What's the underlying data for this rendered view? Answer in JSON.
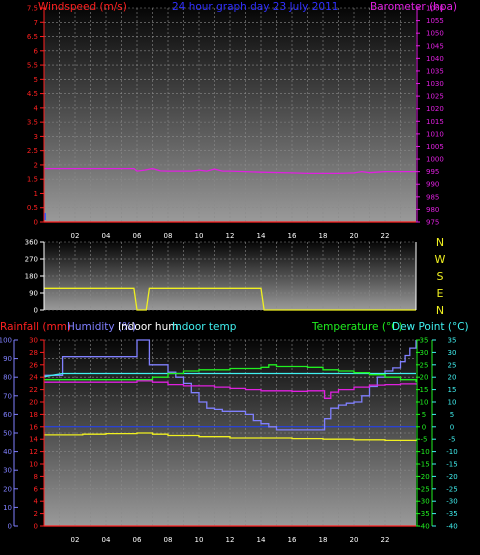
{
  "chart_data": [
    {
      "type": "line",
      "title": "24 hour graph day   23 July 2011",
      "left_axis_label": "Windspeed (m/s)",
      "right_axis_label": "Barometer (hpa)",
      "x_ticks": [
        "02",
        "04",
        "06",
        "08",
        "10",
        "12",
        "14",
        "16",
        "18",
        "20",
        "22"
      ],
      "xlim": [
        0,
        24
      ],
      "left_ylim": [
        0,
        7.5
      ],
      "left_ticks": [
        "0",
        "0.5",
        "1",
        "1.5",
        "2",
        "2.5",
        "3",
        "3.5",
        "4",
        "4.5",
        "5",
        "5.5",
        "6",
        "6.5",
        "7",
        "7.5"
      ],
      "right_ylim": [
        975,
        1060
      ],
      "right_ticks": [
        "975",
        "980",
        "985",
        "990",
        "995",
        "1000",
        "1005",
        "1010",
        "1015",
        "1020",
        "1025",
        "1030",
        "1035",
        "1040",
        "1045",
        "1050",
        "1055",
        "1060"
      ],
      "grid": true,
      "series": [
        {
          "name": "Windspeed (m/s)",
          "axis": "left",
          "color": "#ff2020",
          "x": [
            0,
            24
          ],
          "y": [
            0,
            0
          ]
        },
        {
          "name": "Barometer (hpa)",
          "axis": "right",
          "color": "#e020e0",
          "x": [
            0,
            5.8,
            6.0,
            6.5,
            7.0,
            7.5,
            8.0,
            9.5,
            10.0,
            10.5,
            11.0,
            11.5,
            12.0,
            14.0,
            16.0,
            17.0,
            18.0,
            19.0,
            20.0,
            20.5,
            21.0,
            22.0,
            23.0,
            24.0
          ],
          "y": [
            996.2,
            996.2,
            995.2,
            995.6,
            996.2,
            995.3,
            995.2,
            995.2,
            995.6,
            995.2,
            996.0,
            995.2,
            995.2,
            994.8,
            994.5,
            994.3,
            994.3,
            994.3,
            994.5,
            995.0,
            994.6,
            995.0,
            995.0,
            995.0
          ]
        }
      ]
    },
    {
      "type": "line",
      "title": "",
      "left_ticks": [
        "0",
        "90",
        "180",
        "270",
        "360"
      ],
      "left_ylim": [
        0,
        360
      ],
      "direction_labels": [
        "N",
        "W",
        "S",
        "E",
        "N"
      ],
      "xlim": [
        0,
        24
      ],
      "grid": true,
      "series": [
        {
          "name": "Wind direction",
          "color": "#f0f020",
          "x": [
            0,
            5.8,
            6.0,
            6.6,
            6.8,
            14.0,
            14.2,
            24
          ],
          "y": [
            115,
            115,
            0,
            0,
            115,
            115,
            0,
            0
          ]
        }
      ]
    },
    {
      "type": "line",
      "title": "",
      "labels": {
        "rainfall": "Rainfall (mm)",
        "humidity": "Humidity (%)",
        "indoor_hum": "Indoor hum",
        "indoor_temp": "Indoor temp",
        "temperature": "Temperature (°C)",
        "dew_point": "Dew Point (°C)"
      },
      "x_ticks": [
        "02",
        "04",
        "06",
        "08",
        "10",
        "12",
        "14",
        "16",
        "18",
        "20",
        "22"
      ],
      "xlim": [
        0,
        24
      ],
      "rain_ylim": [
        0,
        100
      ],
      "rain_ticks": [
        "0",
        "10",
        "20",
        "30",
        "40",
        "50",
        "60",
        "70",
        "80",
        "90",
        "100"
      ],
      "hum_ylim": [
        0,
        30
      ],
      "hum_ticks": [
        "0",
        "2",
        "4",
        "6",
        "8",
        "10",
        "12",
        "14",
        "16",
        "18",
        "20",
        "22",
        "24",
        "26",
        "28",
        "30"
      ],
      "temp_ylim": [
        -40,
        35
      ],
      "temp_ticks": [
        "-40",
        "-35",
        "-30",
        "-25",
        "-20",
        "-15",
        "-10",
        "-5",
        "0",
        "5",
        "10",
        "15",
        "20",
        "25",
        "30",
        "35"
      ],
      "grid": true,
      "series": [
        {
          "name": "Rainfall (mm)",
          "axis": "rain",
          "color": "#ff2020",
          "x": [
            0,
            24
          ],
          "y": [
            0,
            0
          ]
        },
        {
          "name": "Humidity (%)",
          "axis": "hum",
          "color": "#8080ff",
          "x": [
            0,
            1.2,
            5.8,
            6.0,
            6.6,
            6.8,
            8.0,
            8.5,
            9.0,
            9.5,
            10.0,
            10.5,
            11.0,
            11.5,
            12.0,
            13.0,
            13.5,
            14.0,
            14.5,
            15.0,
            16.0,
            17.0,
            17.9,
            18.1,
            18.5,
            19.0,
            19.5,
            20.0,
            20.5,
            21.0,
            21.5,
            22.0,
            22.5,
            23.0,
            23.3,
            23.6,
            24.0
          ],
          "y": [
            24.3,
            27.3,
            27.3,
            30.0,
            30.0,
            26.0,
            24.8,
            24.0,
            23.0,
            21.5,
            20.0,
            19.0,
            18.8,
            18.5,
            18.5,
            18.0,
            17.0,
            16.5,
            16.0,
            15.5,
            15.5,
            15.5,
            15.5,
            17.3,
            19.0,
            19.5,
            19.8,
            20.0,
            21.0,
            22.5,
            24.0,
            25.0,
            25.5,
            26.5,
            27.5,
            28.7,
            30.0
          ]
        },
        {
          "name": "Indoor hum",
          "axis": "hum",
          "color": "#f0f020",
          "x": [
            0,
            2.0,
            2.5,
            4.0,
            5.0,
            6.0,
            7.0,
            8.0,
            10.0,
            12.0,
            14.0,
            16.0,
            18.0,
            20.0,
            22.0,
            24.0
          ],
          "y": [
            14.7,
            14.7,
            14.8,
            14.9,
            14.9,
            15.0,
            14.8,
            14.6,
            14.4,
            14.2,
            14.2,
            14.1,
            14.0,
            13.9,
            13.8,
            13.7
          ]
        },
        {
          "name": "Indoor temp",
          "axis": "temp",
          "color": "#40f0f0",
          "x": [
            0,
            1.2,
            24
          ],
          "y": [
            20.2,
            21.5,
            21.5
          ]
        },
        {
          "name": "Temperature (°C)",
          "axis": "temp",
          "color": "#20f020",
          "x": [
            0,
            6.0,
            7.0,
            8.0,
            9.0,
            10.0,
            12.0,
            14.0,
            14.5,
            15.0,
            17.0,
            18.0,
            19.0,
            20.0,
            21.0,
            22.0,
            23.0,
            24.0
          ],
          "y": [
            19.0,
            19.0,
            20.0,
            21.5,
            22.5,
            23.0,
            23.5,
            24.0,
            25.0,
            24.3,
            24.0,
            23.0,
            22.5,
            21.8,
            21.0,
            20.0,
            19.0,
            18.0
          ]
        },
        {
          "name": "Dew Point (°C)",
          "axis": "temp",
          "color": "#e020e0",
          "x": [
            0,
            5.8,
            6.0,
            7.0,
            8.0,
            9.0,
            10.0,
            11.0,
            12.0,
            13.0,
            14.0,
            16.0,
            17.0,
            17.9,
            18.1,
            18.5,
            19.0,
            20.0,
            21.0,
            22.0,
            23.0,
            24.0
          ],
          "y": [
            18.0,
            18.0,
            18.5,
            18.0,
            17.0,
            16.5,
            16.5,
            16.0,
            15.5,
            15.0,
            14.5,
            14.3,
            14.5,
            14.5,
            11.5,
            14.0,
            15.0,
            16.0,
            16.8,
            17.0,
            17.3,
            17.0
          ]
        }
      ]
    }
  ]
}
